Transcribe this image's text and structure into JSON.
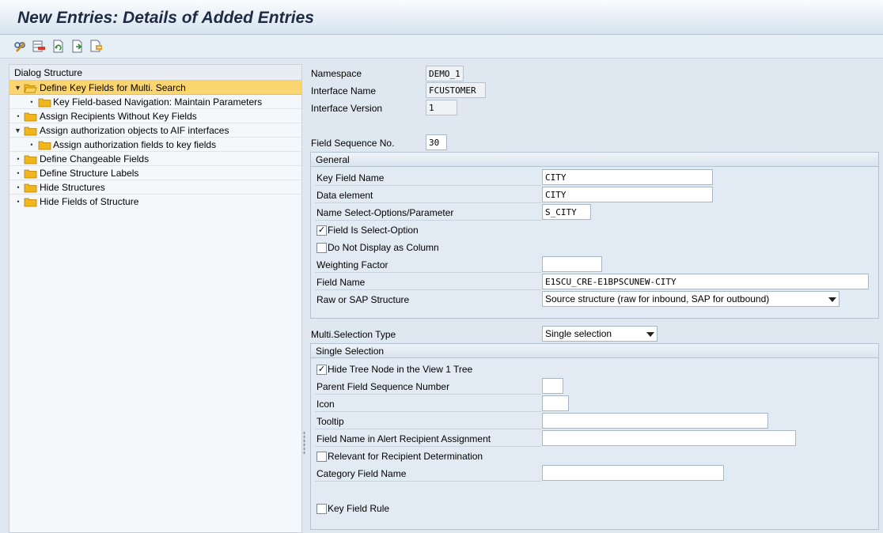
{
  "title": "New Entries: Details of Added Entries",
  "toolbar": {
    "icons": [
      "display-change-icon",
      "delete-row-icon",
      "undo-icon",
      "next-entry-icon",
      "transport-icon"
    ]
  },
  "dialog_structure": {
    "header": "Dialog Structure",
    "items": [
      {
        "label": "Define Key Fields for Multi. Search",
        "level": 0,
        "expanded": true,
        "selected": true
      },
      {
        "label": "Key Field-based Navigation: Maintain Parameters",
        "level": 1
      },
      {
        "label": "Assign Recipients Without Key Fields",
        "level": 0
      },
      {
        "label": "Assign authorization objects to AIF interfaces",
        "level": 0,
        "expanded": true
      },
      {
        "label": "Assign authorization fields to key fields",
        "level": 1
      },
      {
        "label": "Define Changeable Fields",
        "level": 0
      },
      {
        "label": "Define Structure Labels",
        "level": 0
      },
      {
        "label": "Hide Structures",
        "level": 0
      },
      {
        "label": "Hide Fields of Structure",
        "level": 0
      }
    ]
  },
  "header_fields": {
    "namespace_label": "Namespace",
    "namespace_value": "DEMO_1",
    "interface_name_label": "Interface Name",
    "interface_name_value": "FCUSTOMER",
    "interface_version_label": "Interface Version",
    "interface_version_value": "1",
    "field_seq_label": "Field Sequence No.",
    "field_seq_value": "30"
  },
  "general": {
    "header": "General",
    "key_field_name_label": "Key Field Name",
    "key_field_name_value": "CITY",
    "data_element_label": "Data element",
    "data_element_value": "CITY",
    "name_select_label": "Name Select-Options/Parameter",
    "name_select_value": "S_CITY",
    "field_is_select_option_label": "Field Is Select-Option",
    "field_is_select_option_checked": true,
    "do_not_display_label": "Do Not Display as Column",
    "do_not_display_checked": false,
    "weighting_factor_label": "Weighting Factor",
    "weighting_factor_value": "",
    "field_name_label": "Field Name",
    "field_name_value": "E1SCU_CRE-E1BPSCUNEW-CITY",
    "raw_sap_label": "Raw or SAP Structure",
    "raw_sap_value": "Source structure (raw for inbound, SAP for outbound)"
  },
  "multi_selection": {
    "label": "Multi.Selection Type",
    "value": "Single selection"
  },
  "single_selection": {
    "header": "Single Selection",
    "hide_tree_label": "Hide Tree Node in the View 1 Tree",
    "hide_tree_checked": true,
    "parent_seq_label": "Parent Field Sequence Number",
    "parent_seq_value": "",
    "icon_label": "Icon",
    "icon_value": "",
    "tooltip_label": "Tooltip",
    "tooltip_value": "",
    "alert_field_label": "Field Name in Alert Recipient Assignment",
    "alert_field_value": "",
    "relevant_label": "Relevant for Recipient Determination",
    "relevant_checked": false,
    "category_label": "Category Field Name",
    "category_value": "",
    "key_field_rule_label": "Key Field Rule",
    "key_field_rule_checked": false
  },
  "colors": {
    "selection": "#fbd570",
    "folder": "#f2b61d",
    "title": "#1f2a44"
  }
}
